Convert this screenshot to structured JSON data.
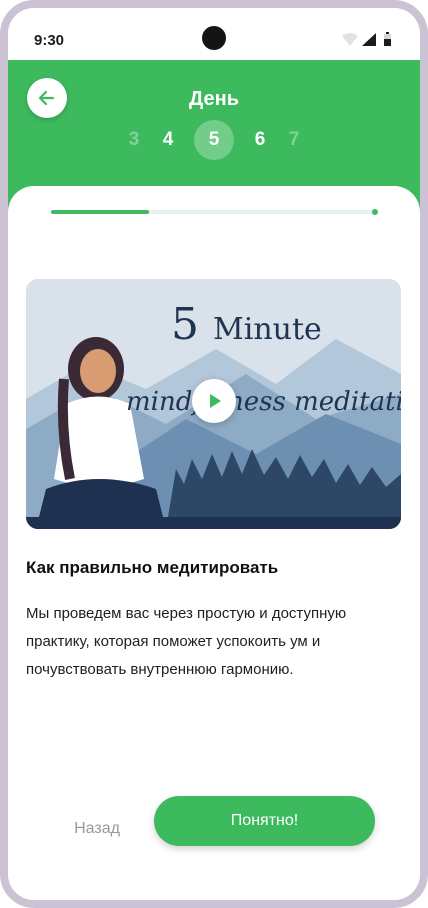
{
  "status_bar": {
    "time": "9:30"
  },
  "header": {
    "title": "День",
    "days": [
      "3",
      "4",
      "5",
      "6",
      "7"
    ],
    "active_day": "5"
  },
  "progress": {
    "fraction": 0.3
  },
  "video": {
    "title_number": "5",
    "title_word": "Minute",
    "subtitle": "mindfulness meditatio"
  },
  "lesson": {
    "title": "Как правильно медитировать",
    "description": "Мы проведем вас через простую и доступную практику, которая поможет успокоить ум и почувствовать внутреннюю гармонию."
  },
  "actions": {
    "back_label": "Назад",
    "ok_label": "Понятно!"
  },
  "colors": {
    "accent": "#3dba5e",
    "frame": "#cbc3d3"
  },
  "icons": [
    "back-arrow-icon",
    "wifi-icon",
    "signal-icon",
    "battery-icon",
    "play-icon"
  ]
}
